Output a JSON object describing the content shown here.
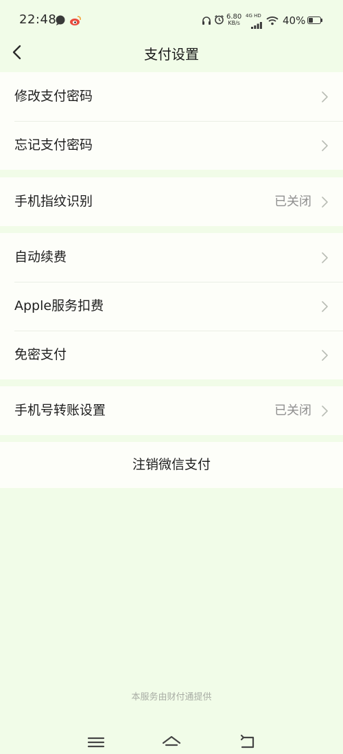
{
  "status_bar": {
    "time": "22:48",
    "net_speed_value": "6.80",
    "net_speed_unit": "KB/s",
    "network_type": "4G HD",
    "battery_percent": "40%",
    "battery_level": 0.4,
    "icons": [
      "message-icon",
      "weibo-icon",
      "headphones-icon",
      "alarm-icon",
      "signal-icon",
      "wifi-icon",
      "battery-icon"
    ]
  },
  "header": {
    "title": "支付设置",
    "back_icon": "chevron-left-icon"
  },
  "groups": [
    {
      "items": [
        {
          "label": "修改支付密码",
          "value": ""
        },
        {
          "label": "忘记支付密码",
          "value": ""
        }
      ]
    },
    {
      "items": [
        {
          "label": "手机指纹识别",
          "value": "已关闭"
        }
      ]
    },
    {
      "items": [
        {
          "label": "自动续费",
          "value": ""
        },
        {
          "label": "Apple服务扣费",
          "value": ""
        },
        {
          "label": "免密支付",
          "value": ""
        }
      ]
    },
    {
      "items": [
        {
          "label": "手机号转账设置",
          "value": "已关闭"
        }
      ]
    }
  ],
  "logout_label": "注销微信支付",
  "footer_note": "本服务由财付通提供",
  "system_nav": {
    "buttons": [
      "menu-icon",
      "home-icon",
      "back-icon"
    ]
  },
  "colors": {
    "background": "#f1fce8",
    "card": "#fdfef9",
    "text": "#1e1e1e",
    "secondary_text": "#8f8f8f"
  }
}
